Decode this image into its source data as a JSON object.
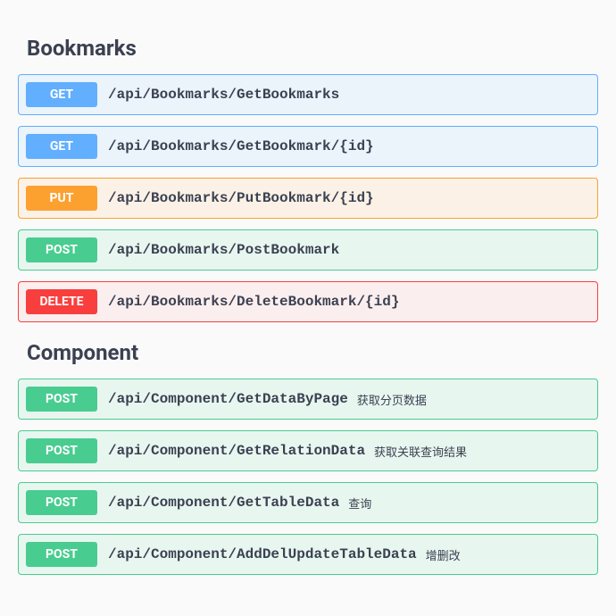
{
  "sections": [
    {
      "title": "Bookmarks",
      "endpoints": [
        {
          "method": "GET",
          "class": "get",
          "path": "/api/Bookmarks/GetBookmarks",
          "desc": ""
        },
        {
          "method": "GET",
          "class": "get",
          "path": "/api/Bookmarks/GetBookmark/{id}",
          "desc": ""
        },
        {
          "method": "PUT",
          "class": "put",
          "path": "/api/Bookmarks/PutBookmark/{id}",
          "desc": ""
        },
        {
          "method": "POST",
          "class": "post",
          "path": "/api/Bookmarks/PostBookmark",
          "desc": ""
        },
        {
          "method": "DELETE",
          "class": "delete",
          "path": "/api/Bookmarks/DeleteBookmark/{id}",
          "desc": ""
        }
      ]
    },
    {
      "title": "Component",
      "endpoints": [
        {
          "method": "POST",
          "class": "post",
          "path": "/api/Component/GetDataByPage",
          "desc": "获取分页数据"
        },
        {
          "method": "POST",
          "class": "post",
          "path": "/api/Component/GetRelationData",
          "desc": "获取关联查询结果"
        },
        {
          "method": "POST",
          "class": "post",
          "path": "/api/Component/GetTableData",
          "desc": "查询"
        },
        {
          "method": "POST",
          "class": "post",
          "path": "/api/Component/AddDelUpdateTableData",
          "desc": "增删改"
        }
      ]
    }
  ]
}
